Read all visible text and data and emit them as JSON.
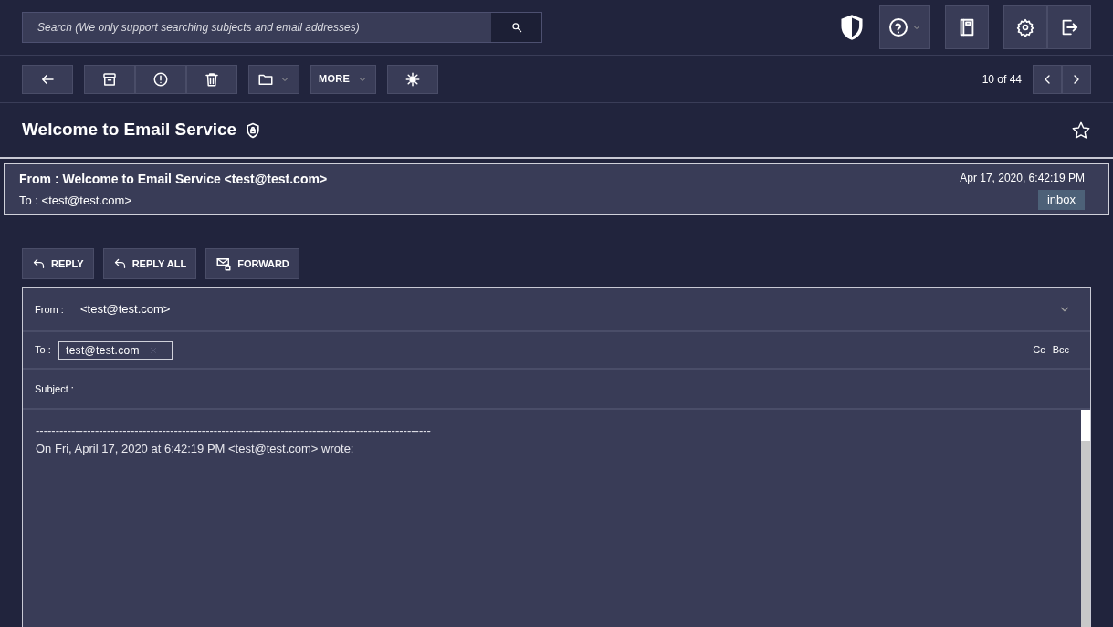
{
  "search": {
    "placeholder": "Search (We only support searching subjects and email addresses)"
  },
  "toolbar": {
    "more_label": "MORE",
    "position": "10 of 44"
  },
  "message": {
    "subject": "Welcome to Email Service",
    "starred": false,
    "from": "From : Welcome to Email Service <test@test.com>",
    "to": "To : <test@test.com>",
    "date": "Apr 17, 2020, 6:42:19 PM",
    "label": "inbox"
  },
  "actions": [
    {
      "kind": "reply",
      "label": "REPLY"
    },
    {
      "kind": "reply",
      "label": "REPLY ALL"
    },
    {
      "kind": "forward",
      "label": "FORWARD"
    }
  ],
  "composer": {
    "from_label": "From :",
    "from_value": "<test@test.com>",
    "to_label": "To :",
    "recipients": [
      "test@test.com"
    ],
    "cc": "Cc",
    "bcc": "Bcc",
    "subject_label": "Subject :",
    "body": [
      "----------------------------------------------------------------------------------------------------",
      "On Fri, April 17, 2020 at 6:42:19 PM <test@test.com> wrote:"
    ]
  }
}
